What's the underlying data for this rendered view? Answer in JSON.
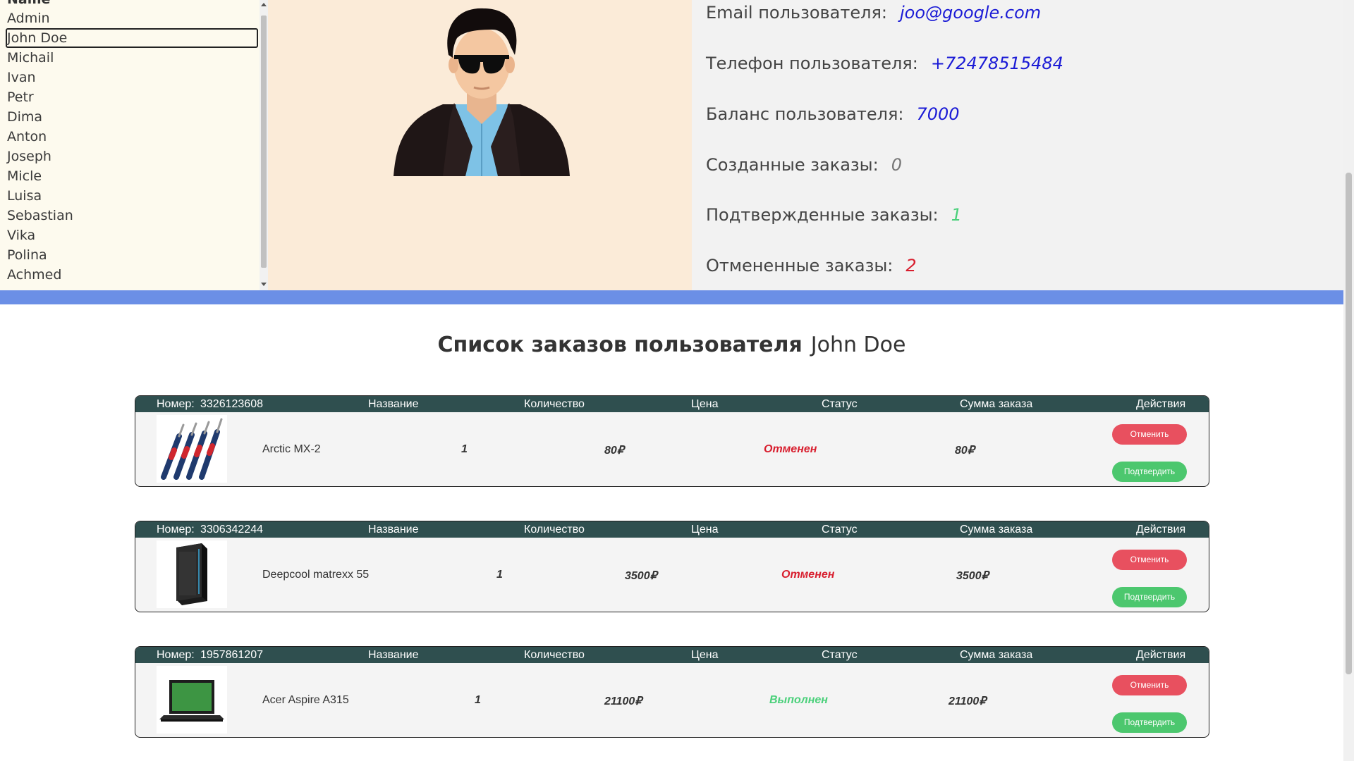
{
  "users": {
    "header": "Name",
    "items": [
      "Admin",
      "John Doe",
      "Michail",
      "Ivan",
      "Petr",
      "Dima",
      "Anton",
      "Joseph",
      "Micle",
      "Luisa",
      "Sebastian",
      "Vika",
      "Polina",
      "Achmed"
    ],
    "selected": "John Doe"
  },
  "avatar": {
    "icon": "user-avatar-icon"
  },
  "info": {
    "email": {
      "label": "Email пользователя:",
      "value": "joo@google.com"
    },
    "phone": {
      "label": "Телефон пользователя:",
      "value": "+72478515484"
    },
    "balance": {
      "label": "Баланс пользователя:",
      "value": "7000"
    },
    "created": {
      "label": "Созданные заказы:",
      "value": "0"
    },
    "confirmed": {
      "label": "Подтвержденные заказы:",
      "value": "1"
    },
    "cancelled": {
      "label": "Отмененные заказы:",
      "value": "2"
    }
  },
  "orders_section": {
    "title": "Список заказов пользователя",
    "user": "John Doe"
  },
  "order_headers": {
    "number": "Номер:",
    "name": "Название",
    "qty": "Количество",
    "price": "Цена",
    "status": "Статус",
    "sum": "Сумма заказа",
    "actions": "Действия"
  },
  "buttons": {
    "cancel": "Отменить",
    "confirm": "Подтвердить"
  },
  "orders": [
    {
      "number": "3326123608",
      "name": "Arctic MX-2",
      "qty": "1",
      "price": "80₽",
      "status": "Отменен",
      "sum": "80₽",
      "status_color": "#d81e2e",
      "image": "thermal-paste-icon"
    },
    {
      "number": "3306342244",
      "name": "Deepcool matrexx 55",
      "qty": "1",
      "price": "3500₽",
      "status": "Отменен",
      "sum": "3500₽",
      "status_color": "#d81e2e",
      "image": "pc-case-icon"
    },
    {
      "number": "1957861207",
      "name": "Acer Aspire A315",
      "qty": "1",
      "price": "21100₽",
      "status": "Выполнен",
      "sum": "21100₽",
      "status_color": "#4ad07a",
      "image": "laptop-icon"
    }
  ],
  "colors": {
    "header_bg": "#2f4f4f",
    "divider": "#6b8fe6",
    "cancel": "#e8505f",
    "confirm": "#4cc76e"
  }
}
